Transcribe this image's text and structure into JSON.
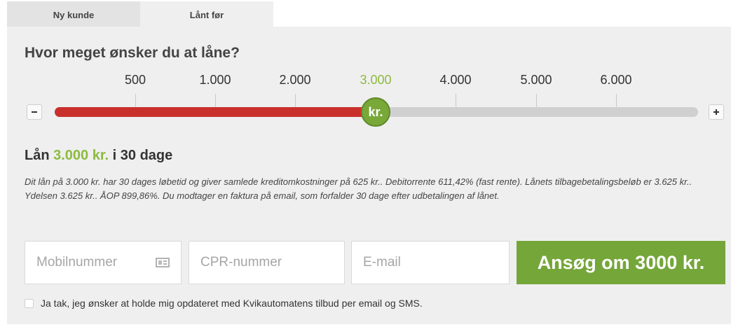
{
  "tabs": {
    "new_customer": "Ny kunde",
    "borrowed_before": "Lånt før"
  },
  "heading": "Hvor meget ønsker du at låne?",
  "slider": {
    "ticks": [
      "500",
      "1.000",
      "2.000",
      "3.000",
      "4.000",
      "5.000",
      "6.000"
    ],
    "selected_tick": "3.000",
    "thumb_label": "kr.",
    "minus_icon": "minus-icon",
    "plus_icon": "plus-icon"
  },
  "summary": {
    "prefix": "Lån",
    "amount": "3.000 kr.",
    "suffix": "i 30 dage"
  },
  "terms": "Dit lån på 3.000 kr. har 30 dages løbetid og giver samlede kreditomkostninger på 625 kr.. Debitorrente 611,42% (fast rente). Lånets tilbagebetalingsbeløb er 3.625 kr.. Ydelsen 3.625 kr.. ÅOP 899,86%. Du modtager en faktura på email, som forfalder 30 dage efter udbetalingen af lånet.",
  "form": {
    "mobile_placeholder": "Mobilnummer",
    "cpr_placeholder": "CPR-nummer",
    "email_placeholder": "E-mail",
    "submit_label": "Ansøg om 3000 kr."
  },
  "consent": "Ja tak, jeg ønsker at holde mig opdateret med Kvikautomatens tilbud per email og SMS.",
  "colors": {
    "accent_green": "#75a63a",
    "slider_red": "#c9302c"
  }
}
